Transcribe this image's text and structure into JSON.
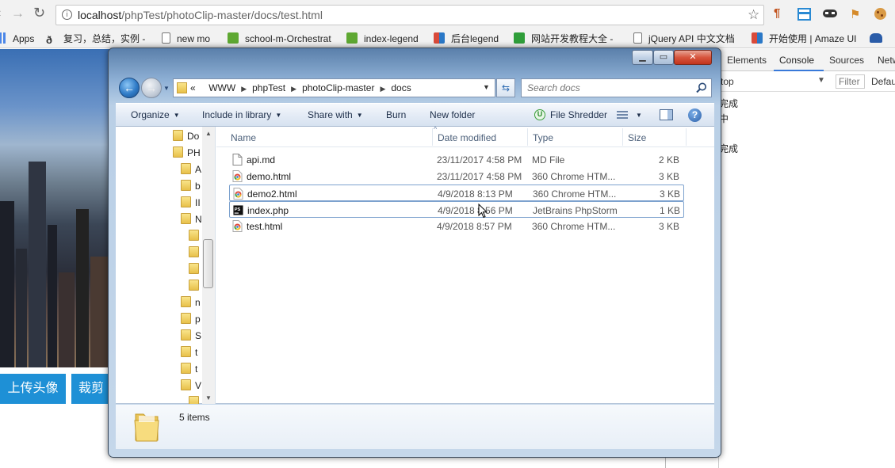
{
  "browser": {
    "url_host": "localhost",
    "url_path": "/phpTest/photoClip-master/docs/test.html",
    "bookmarks": [
      {
        "label": "Apps",
        "color": "#4a86e8"
      },
      {
        "label": "复习，总结，实例 -",
        "color": "#555555"
      },
      {
        "label": "new mo",
        "color": "#ffffff"
      },
      {
        "label": "school-m-Orchestrat",
        "color": "#5ea832"
      },
      {
        "label": "index-legend",
        "color": "#5ea832"
      },
      {
        "label": "后台legend",
        "color": "#d94a3a"
      },
      {
        "label": "网站开发教程大全 -",
        "color": "#2f9e3a"
      },
      {
        "label": "jQuery API 中文文档",
        "color": "#ffffff"
      },
      {
        "label": "开始使用 | Amaze UI",
        "color": "#d94a3a"
      }
    ]
  },
  "page": {
    "buttons": [
      "上传头像",
      "裁剪"
    ]
  },
  "devtools": {
    "tabs": [
      "Elements",
      "Console",
      "Sources",
      "Netw"
    ],
    "context": "top",
    "filter_placeholder": "Filter",
    "level": "Defau",
    "messages": [
      "完成",
      "中",
      "完成"
    ]
  },
  "explorer": {
    "breadcrumb": [
      "«",
      "WWW",
      "phpTest",
      "photoClip-master",
      "docs"
    ],
    "search_placeholder": "Search docs",
    "toolbar": {
      "organize": "Organize",
      "include": "Include in library",
      "share": "Share with",
      "burn": "Burn",
      "new_folder": "New folder",
      "shredder": "File Shredder"
    },
    "tree": [
      "Do",
      "PH",
      "A",
      "b",
      "II",
      "N",
      "",
      "",
      "",
      "",
      "n",
      "p",
      "S",
      "t",
      "t",
      "V",
      ""
    ],
    "columns": [
      "Name",
      "Date modified",
      "Type",
      "Size"
    ],
    "files": [
      {
        "name": "api.md",
        "date": "23/11/2017 4:58 PM",
        "type": "MD File",
        "size": "2 KB",
        "icon": "file-icon"
      },
      {
        "name": "demo.html",
        "date": "23/11/2017 4:58 PM",
        "type": "360 Chrome HTM...",
        "size": "3 KB",
        "icon": "chrome-icon"
      },
      {
        "name": "demo2.html",
        "date": "4/9/2018 8:13 PM",
        "type": "360 Chrome HTM...",
        "size": "3 KB",
        "icon": "chrome-icon"
      },
      {
        "name": "index.php",
        "date": "4/9/2018 8:56 PM",
        "type": "JetBrains PhpStorm",
        "size": "1 KB",
        "icon": "phpstorm-icon"
      },
      {
        "name": "test.html",
        "date": "4/9/2018 8:57 PM",
        "type": "360 Chrome HTM...",
        "size": "3 KB",
        "icon": "chrome-icon"
      }
    ],
    "status": "5 items"
  }
}
